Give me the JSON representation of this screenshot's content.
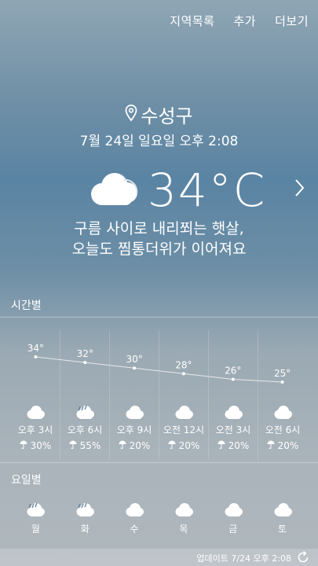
{
  "topbar": {
    "locations": "지역목록",
    "add": "추가",
    "more": "더보기"
  },
  "location": {
    "name": "수성구",
    "icon": "location-pin-icon"
  },
  "datetime": "7월 24일 일요일 오후 2:08",
  "current": {
    "temperature": "34°C",
    "icon": "cloudy-icon"
  },
  "description": {
    "line1": "구름 사이로 내리쬐는 햇살,",
    "line2": "오늘도 찜통더위가 이어져요"
  },
  "hourly": {
    "label": "시간별",
    "items": [
      {
        "temp_label": "34°",
        "temp": 34,
        "time": "오후 3시",
        "pop": "30%",
        "icon": "cloudy-icon"
      },
      {
        "temp_label": "32°",
        "temp": 32,
        "time": "오후 6시",
        "pop": "55%",
        "icon": "rain-cloud-icon"
      },
      {
        "temp_label": "30°",
        "temp": 30,
        "time": "오후 9시",
        "pop": "20%",
        "icon": "cloudy-icon"
      },
      {
        "temp_label": "28°",
        "temp": 28,
        "time": "오전 12시",
        "pop": "20%",
        "icon": "cloudy-icon"
      },
      {
        "temp_label": "26°",
        "temp": 26,
        "time": "오전 3시",
        "pop": "20%",
        "icon": "cloudy-icon"
      },
      {
        "temp_label": "25°",
        "temp": 25,
        "time": "오전 6시",
        "pop": "20%",
        "icon": "cloudy-icon"
      }
    ]
  },
  "daily": {
    "label": "요일별",
    "items": [
      {
        "day": "월",
        "icon": "rain-cloud-icon"
      },
      {
        "day": "화",
        "icon": "rain-cloud-icon"
      },
      {
        "day": "수",
        "icon": "cloudy-icon"
      },
      {
        "day": "목",
        "icon": "cloudy-icon"
      },
      {
        "day": "금",
        "icon": "cloudy-icon"
      },
      {
        "day": "토",
        "icon": "cloudy-icon"
      }
    ]
  },
  "footer": {
    "update": "업데이트 7/24  오후 2:08"
  }
}
